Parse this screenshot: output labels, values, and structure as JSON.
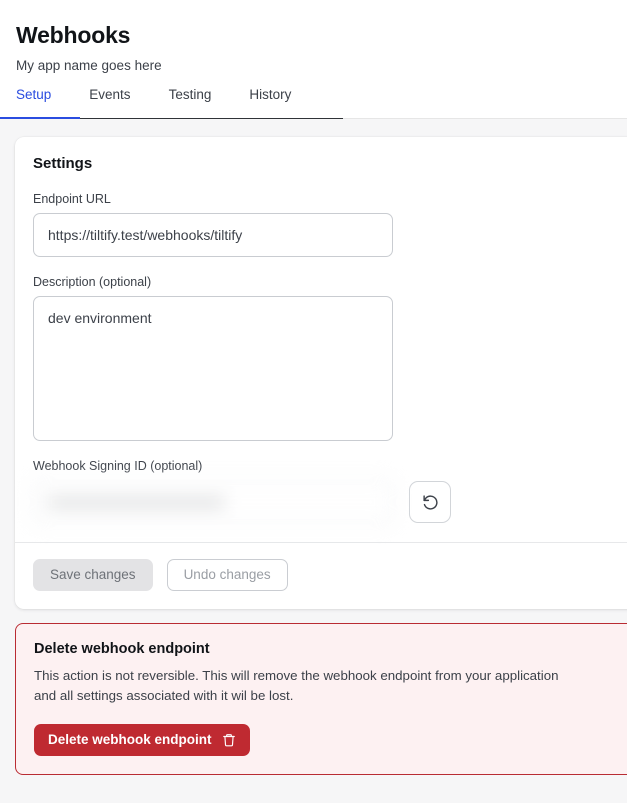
{
  "header": {
    "title": "Webhooks",
    "subtitle": "My app name goes here"
  },
  "tabs": [
    {
      "label": "Setup",
      "active": true
    },
    {
      "label": "Events",
      "active": false
    },
    {
      "label": "Testing",
      "active": false
    },
    {
      "label": "History",
      "active": false
    }
  ],
  "settings": {
    "card_title": "Settings",
    "endpoint": {
      "label": "Endpoint URL",
      "value": "https://tiltify.test/webhooks/tiltify",
      "placeholder": "https://"
    },
    "description": {
      "label": "Description (optional)",
      "value": "dev environment",
      "placeholder": ""
    },
    "signing_id": {
      "label": "Webhook Signing ID (optional)",
      "value": "••••••••••••••••••••••••••••••••••••",
      "redacted": true,
      "refresh_icon": "rotate-ccw-icon"
    },
    "save_label": "Save changes",
    "undo_label": "Undo changes"
  },
  "danger": {
    "title": "Delete webhook endpoint",
    "description": "This action is not reversible. This will remove the webhook endpoint from your application and all settings associated with it wil be lost.",
    "button_label": "Delete webhook endpoint",
    "button_icon": "trash-icon"
  },
  "colors": {
    "accent_blue": "#2a4ce0",
    "danger_red": "#bf2a31",
    "danger_bg": "#fdf1f2",
    "page_bg": "#f6f6f7"
  }
}
